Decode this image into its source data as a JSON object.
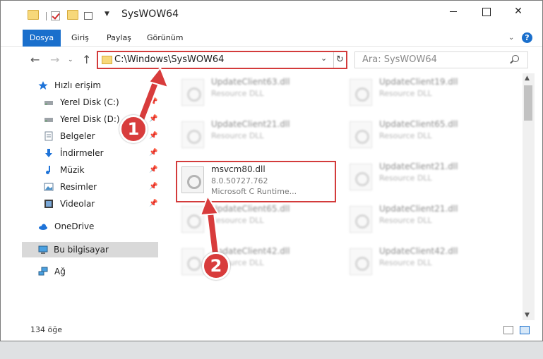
{
  "window": {
    "title": "SysWOW64",
    "controls": {
      "minimize": "",
      "maximize": "",
      "close": "✕"
    }
  },
  "ribbon": {
    "tabs": [
      "Dosya",
      "Giriş",
      "Paylaş",
      "Görünüm"
    ],
    "help": "?"
  },
  "address": {
    "path": "C:\\Windows\\SysWOW64",
    "search_placeholder": "Ara: SysWOW64"
  },
  "sidebar": {
    "items": [
      {
        "label": "Hızlı erişim",
        "icon": "star-icon"
      },
      {
        "label": "Yerel Disk (C:)",
        "icon": "drive-icon"
      },
      {
        "label": "Yerel Disk (D:)",
        "icon": "drive-icon"
      },
      {
        "label": "Belgeler",
        "icon": "document-icon"
      },
      {
        "label": "İndirmeler",
        "icon": "download-icon"
      },
      {
        "label": "Müzik",
        "icon": "music-icon"
      },
      {
        "label": "Resimler",
        "icon": "pictures-icon"
      },
      {
        "label": "Videolar",
        "icon": "video-icon"
      },
      {
        "label": "OneDrive",
        "icon": "cloud-icon"
      },
      {
        "label": "Bu bilgisayar",
        "icon": "computer-icon"
      },
      {
        "label": "Ağ",
        "icon": "network-icon"
      }
    ]
  },
  "files": [
    {
      "name": "UpdateClient63.dll",
      "type": "Resource DLL"
    },
    {
      "name": "UpdateClient19.dll",
      "type": "Resource DLL"
    },
    {
      "name": "UpdateClient21.dll",
      "type": "Resource DLL"
    },
    {
      "name": "UpdateClient65.dll",
      "type": "Resource DLL"
    },
    {
      "name": "msvcm80.dll",
      "type": "8.0.50727.762",
      "desc": "Microsoft C Runtime..."
    },
    {
      "name": "UpdateClient21.dll",
      "type": "Resource DLL"
    },
    {
      "name": "UpdateClient65.dll",
      "type": "Resource DLL"
    },
    {
      "name": "UpdateClient21.dll",
      "type": "Resource DLL"
    },
    {
      "name": "UpdateClient42.dll",
      "type": "Resource DLL"
    },
    {
      "name": "UpdateClient42.dll",
      "type": "Resource DLL"
    }
  ],
  "status": {
    "count": "134 öğe"
  },
  "annotations": {
    "step1": "1",
    "step2": "2"
  },
  "colors": {
    "accent": "#1a6fcc",
    "highlight": "#d33b3b",
    "annotation": "#d83c3c"
  }
}
